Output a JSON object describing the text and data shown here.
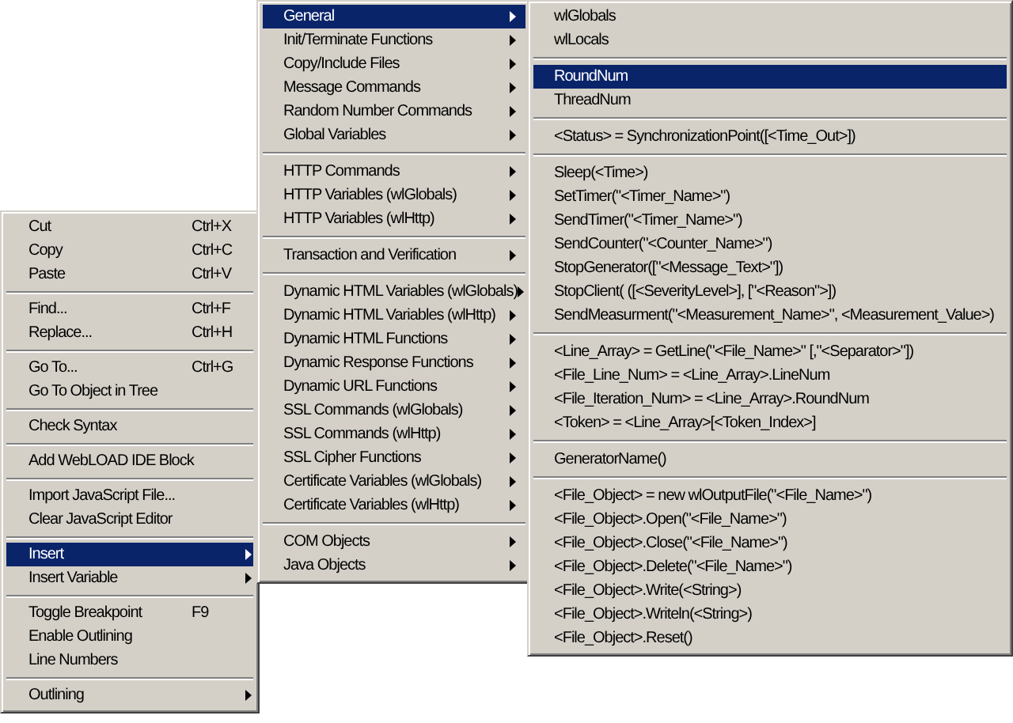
{
  "menus": [
    {
      "items": [
        {
          "kind": "item",
          "label": "Cut",
          "shortcut": "Ctrl+X",
          "submenu": false,
          "selected": false
        },
        {
          "kind": "item",
          "label": "Copy",
          "shortcut": "Ctrl+C",
          "submenu": false,
          "selected": false
        },
        {
          "kind": "item",
          "label": "Paste",
          "shortcut": "Ctrl+V",
          "submenu": false,
          "selected": false
        },
        {
          "kind": "separator"
        },
        {
          "kind": "item",
          "label": "Find...",
          "shortcut": "Ctrl+F",
          "submenu": false,
          "selected": false
        },
        {
          "kind": "item",
          "label": "Replace...",
          "shortcut": "Ctrl+H",
          "submenu": false,
          "selected": false
        },
        {
          "kind": "separator"
        },
        {
          "kind": "item",
          "label": "Go To...",
          "shortcut": "Ctrl+G",
          "submenu": false,
          "selected": false
        },
        {
          "kind": "item",
          "label": "Go To Object in Tree",
          "submenu": false,
          "selected": false
        },
        {
          "kind": "separator"
        },
        {
          "kind": "item",
          "label": "Check Syntax",
          "submenu": false,
          "selected": false
        },
        {
          "kind": "separator"
        },
        {
          "kind": "item",
          "label": "Add WebLOAD IDE Block",
          "submenu": false,
          "selected": false
        },
        {
          "kind": "separator"
        },
        {
          "kind": "item",
          "label": "Import JavaScript File...",
          "submenu": false,
          "selected": false
        },
        {
          "kind": "item",
          "label": "Clear JavaScript Editor",
          "submenu": false,
          "selected": false
        },
        {
          "kind": "separator"
        },
        {
          "kind": "item",
          "label": "Insert",
          "submenu": true,
          "selected": true
        },
        {
          "kind": "item",
          "label": "Insert Variable",
          "submenu": true,
          "selected": false
        },
        {
          "kind": "separator"
        },
        {
          "kind": "item",
          "label": "Toggle Breakpoint",
          "shortcut": "F9",
          "submenu": false,
          "selected": false
        },
        {
          "kind": "item",
          "label": "Enable Outlining",
          "submenu": false,
          "selected": false
        },
        {
          "kind": "item",
          "label": "Line Numbers",
          "submenu": false,
          "selected": false
        },
        {
          "kind": "separator"
        },
        {
          "kind": "item",
          "label": "Outlining",
          "submenu": true,
          "selected": false
        }
      ]
    },
    {
      "items": [
        {
          "kind": "item",
          "label": "General",
          "submenu": true,
          "selected": true
        },
        {
          "kind": "item",
          "label": "Init/Terminate Functions",
          "submenu": true,
          "selected": false
        },
        {
          "kind": "item",
          "label": "Copy/Include Files",
          "submenu": true,
          "selected": false
        },
        {
          "kind": "item",
          "label": "Message Commands",
          "submenu": true,
          "selected": false
        },
        {
          "kind": "item",
          "label": "Random Number Commands",
          "submenu": true,
          "selected": false
        },
        {
          "kind": "item",
          "label": "Global Variables",
          "submenu": true,
          "selected": false
        },
        {
          "kind": "separator"
        },
        {
          "kind": "item",
          "label": "HTTP Commands",
          "submenu": true,
          "selected": false
        },
        {
          "kind": "item",
          "label": "HTTP Variables (wlGlobals)",
          "submenu": true,
          "selected": false
        },
        {
          "kind": "item",
          "label": "HTTP Variables (wlHttp)",
          "submenu": true,
          "selected": false
        },
        {
          "kind": "separator"
        },
        {
          "kind": "item",
          "label": "Transaction and Verification",
          "submenu": true,
          "selected": false
        },
        {
          "kind": "separator"
        },
        {
          "kind": "item",
          "label": "Dynamic HTML Variables (wlGlobals)",
          "submenu": true,
          "selected": false
        },
        {
          "kind": "item",
          "label": "Dynamic HTML Variables (wlHttp)",
          "submenu": true,
          "selected": false
        },
        {
          "kind": "item",
          "label": "Dynamic HTML Functions",
          "submenu": true,
          "selected": false
        },
        {
          "kind": "item",
          "label": "Dynamic Response Functions",
          "submenu": true,
          "selected": false
        },
        {
          "kind": "item",
          "label": "Dynamic URL Functions",
          "submenu": true,
          "selected": false
        },
        {
          "kind": "item",
          "label": "SSL Commands (wlGlobals)",
          "submenu": true,
          "selected": false
        },
        {
          "kind": "item",
          "label": "SSL Commands (wlHttp)",
          "submenu": true,
          "selected": false
        },
        {
          "kind": "item",
          "label": "SSL Cipher Functions",
          "submenu": true,
          "selected": false
        },
        {
          "kind": "item",
          "label": "Certificate Variables (wlGlobals)",
          "submenu": true,
          "selected": false
        },
        {
          "kind": "item",
          "label": "Certificate Variables (wlHttp)",
          "submenu": true,
          "selected": false
        },
        {
          "kind": "separator"
        },
        {
          "kind": "item",
          "label": "COM Objects",
          "submenu": true,
          "selected": false
        },
        {
          "kind": "item",
          "label": "Java Objects",
          "submenu": true,
          "selected": false
        }
      ]
    },
    {
      "items": [
        {
          "kind": "item",
          "label": "wlGlobals",
          "submenu": false,
          "selected": false
        },
        {
          "kind": "item",
          "label": "wlLocals",
          "submenu": false,
          "selected": false
        },
        {
          "kind": "separator"
        },
        {
          "kind": "item",
          "label": "RoundNum",
          "submenu": false,
          "selected": true
        },
        {
          "kind": "item",
          "label": "ThreadNum",
          "submenu": false,
          "selected": false
        },
        {
          "kind": "separator"
        },
        {
          "kind": "item",
          "label": "<Status> = SynchronizationPoint([<Time_Out>])",
          "submenu": false,
          "selected": false
        },
        {
          "kind": "separator"
        },
        {
          "kind": "item",
          "label": "Sleep(<Time>)",
          "submenu": false,
          "selected": false
        },
        {
          "kind": "item",
          "label": "SetTimer(\"<Timer_Name>\")",
          "submenu": false,
          "selected": false
        },
        {
          "kind": "item",
          "label": "SendTimer(\"<Timer_Name>\")",
          "submenu": false,
          "selected": false
        },
        {
          "kind": "item",
          "label": "SendCounter(\"<Counter_Name>\")",
          "submenu": false,
          "selected": false
        },
        {
          "kind": "item",
          "label": "StopGenerator([\"<Message_Text>\"])",
          "submenu": false,
          "selected": false
        },
        {
          "kind": "item",
          "label": "StopClient( ([<SeverityLevel>], [\"<Reason\">])",
          "submenu": false,
          "selected": false
        },
        {
          "kind": "item",
          "label": "SendMeasurment(\"<Measurement_Name>\", <Measurement_Value>)",
          "submenu": false,
          "selected": false
        },
        {
          "kind": "separator"
        },
        {
          "kind": "item",
          "label": "<Line_Array> = GetLine(\"<File_Name>\" [,\"<Separator>\"])",
          "submenu": false,
          "selected": false
        },
        {
          "kind": "item",
          "label": "<File_Line_Num> = <Line_Array>.LineNum",
          "submenu": false,
          "selected": false
        },
        {
          "kind": "item",
          "label": "<File_Iteration_Num> = <Line_Array>.RoundNum",
          "submenu": false,
          "selected": false
        },
        {
          "kind": "item",
          "label": "<Token> = <Line_Array>[<Token_Index>]",
          "submenu": false,
          "selected": false
        },
        {
          "kind": "separator"
        },
        {
          "kind": "item",
          "label": "GeneratorName()",
          "submenu": false,
          "selected": false
        },
        {
          "kind": "separator"
        },
        {
          "kind": "item",
          "label": "<File_Object> = new wlOutputFile(\"<File_Name>\")",
          "submenu": false,
          "selected": false
        },
        {
          "kind": "item",
          "label": "<File_Object>.Open(\"<File_Name>\")",
          "submenu": false,
          "selected": false
        },
        {
          "kind": "item",
          "label": "<File_Object>.Close(\"<File_Name>\")",
          "submenu": false,
          "selected": false
        },
        {
          "kind": "item",
          "label": "<File_Object>.Delete(\"<File_Name>\")",
          "submenu": false,
          "selected": false
        },
        {
          "kind": "item",
          "label": "<File_Object>.Write(<String>)",
          "submenu": false,
          "selected": false
        },
        {
          "kind": "item",
          "label": "<File_Object>.Writeln(<String>)",
          "submenu": false,
          "selected": false
        },
        {
          "kind": "item",
          "label": "<File_Object>.Reset()",
          "submenu": false,
          "selected": false
        }
      ]
    }
  ]
}
